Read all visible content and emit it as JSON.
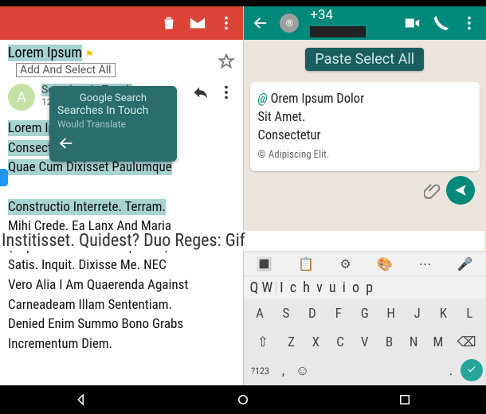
{
  "gmail": {
    "title_chip": "Lorem Ipsum",
    "snippet_line": "Add And Select All",
    "avatar": "A",
    "msg": {
      "sub": "Searches In Touch",
      "time": "12"
    },
    "tooltip": {
      "row1": "Google Search",
      "row2": "Searches In Touch",
      "row3": "Would Translate"
    },
    "body": "Lorem Ipsum Dolor Sit Amet. Consectetur Adipiscing Elit. Quae Cum Dixisset Paulumque Institisset. Quidest? Duo Reges: Constructio Interrete. Terram. Mihi Crede. Ea Lanx And Maria (Deprimet. Putabam Equidem) Satis. Inquit. Dixisse Me. NEC Vero Alia I Am Quaerenda Against Carneadeam Illam Sententiam. Denied Enim Summo Bono Grabs Incrementum Diem."
  },
  "overlay": "Institisset. Quidest? Duo Reges: Gif",
  "wa": {
    "phone_prefix": "+34",
    "pill": "Paste Select All",
    "msg": {
      "at": "@",
      "l1": " Orem Ipsum Dolor",
      "l2": "Sit Amet.",
      "l3": "Consectetur",
      "l4": "© Adipiscing Elit."
    },
    "sugg": {
      "w1": "Q W",
      "w2": "I c h v u i o p"
    },
    "rows": {
      "r1": [
        "A",
        "S",
        "D",
        "F",
        "G",
        "H",
        "J",
        "K",
        "L"
      ],
      "r2": [
        "Z",
        "X",
        "C",
        "V",
        "B",
        "N",
        "M"
      ]
    },
    "sym": "?123",
    "comma": ","
  }
}
